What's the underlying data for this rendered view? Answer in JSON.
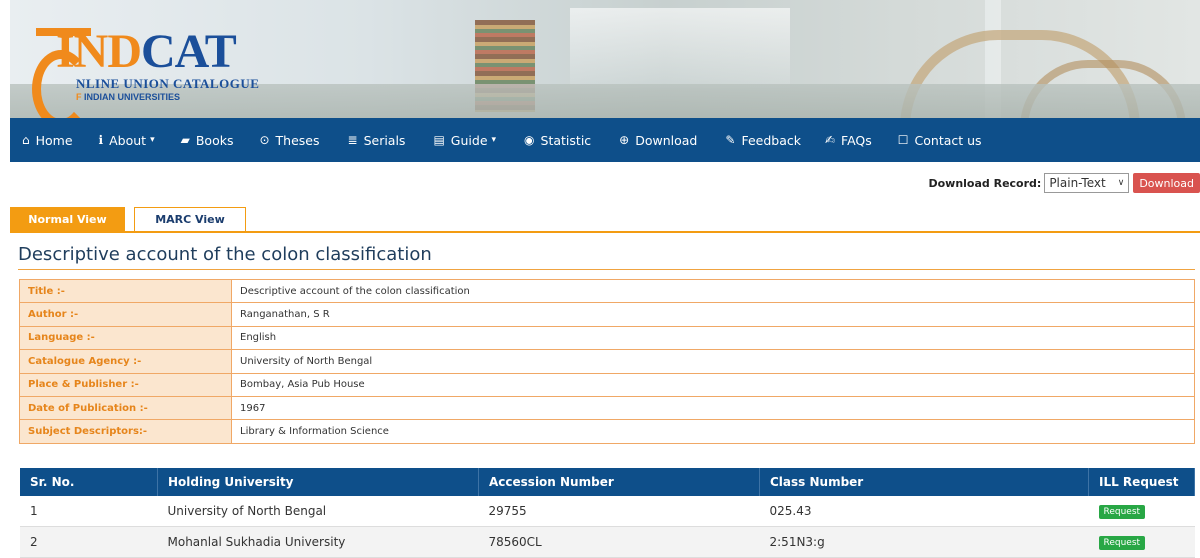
{
  "logo": {
    "brand_ind": "IND",
    "brand_cat": "CAT",
    "line1": "NLINE UNION CATALOGUE",
    "line2_o": "F",
    "line2": " INDIAN UNIVERSITIES"
  },
  "nav": [
    {
      "label": "Home",
      "icon": "home-icon",
      "glyph": "⌂"
    },
    {
      "label": "About",
      "icon": "info-icon",
      "glyph": "ℹ",
      "caret": "▾"
    },
    {
      "label": "Books",
      "icon": "book-icon",
      "glyph": "▰"
    },
    {
      "label": "Theses",
      "icon": "target-icon",
      "glyph": "⊙"
    },
    {
      "label": "Serials",
      "icon": "newspaper-icon",
      "glyph": "≣"
    },
    {
      "label": "Guide",
      "icon": "list-icon",
      "glyph": "▤",
      "caret": "▾"
    },
    {
      "label": "Statistic",
      "icon": "radio-icon",
      "glyph": "◉"
    },
    {
      "label": "Download",
      "icon": "download-icon",
      "glyph": "⊕"
    },
    {
      "label": "Feedback",
      "icon": "pencil-icon",
      "glyph": "✎"
    },
    {
      "label": "FAQs",
      "icon": "edit-icon",
      "glyph": "✍"
    },
    {
      "label": "Contact us",
      "icon": "square-icon",
      "glyph": "☐"
    }
  ],
  "download": {
    "label": "Download Record:",
    "format": "Plain-Text",
    "button": "Download"
  },
  "tabs": {
    "normal": "Normal View",
    "marc": "MARC View"
  },
  "title": "Descriptive account of the colon classification",
  "details": [
    {
      "key": "Title :-",
      "value": "Descriptive account of the colon classification"
    },
    {
      "key": "Author :-",
      "value": "Ranganathan, S R"
    },
    {
      "key": "Language :-",
      "value": "English"
    },
    {
      "key": "Catalogue Agency :-",
      "value": "University of North Bengal"
    },
    {
      "key": "Place & Publisher :-",
      "value": "Bombay, Asia Pub House"
    },
    {
      "key": "Date of Publication :-",
      "value": "1967"
    },
    {
      "key": "Subject Descriptors:-",
      "value": "Library & Information Science"
    }
  ],
  "holdings": {
    "headers": [
      "Sr. No.",
      "Holding University",
      "Accession Number",
      "Class Number",
      "ILL Request"
    ],
    "rows": [
      {
        "sr": "1",
        "university": "University of North Bengal",
        "accession": "29755",
        "class": "025.43",
        "request": "Request"
      },
      {
        "sr": "2",
        "university": "Mohanlal Sukhadia University",
        "accession": "78560CL",
        "class": "2:51N3:g",
        "request": "Request"
      }
    ]
  },
  "colors": {
    "nav_bg": "#0e4f8a",
    "accent_orange": "#f39c12",
    "download_red": "#d9534f",
    "request_green": "#28a745"
  }
}
